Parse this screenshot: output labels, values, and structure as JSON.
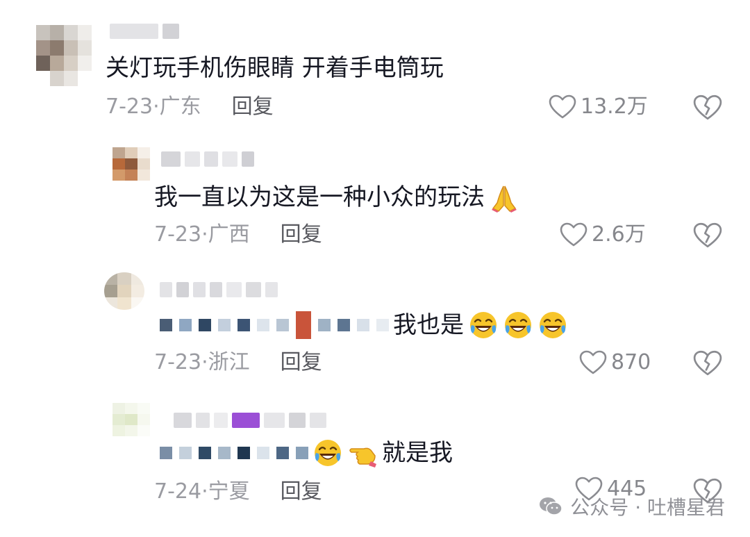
{
  "comments": [
    {
      "text": "关灯玩手机伤眼睛  开着手电筒玩",
      "date": "7-23",
      "sep": "·",
      "region": "广东",
      "reply_label": "回复",
      "likes": "13.2万"
    },
    {
      "text": "我一直以为这是一种小众的玩法",
      "date": "7-23",
      "sep": "·",
      "region": "广西",
      "reply_label": "回复",
      "likes": "2.6万"
    },
    {
      "text": "我也是",
      "date": "7-23",
      "sep": "·",
      "region": "浙江",
      "reply_label": "回复",
      "likes": "870"
    },
    {
      "text": "就是我",
      "date": "7-24",
      "sep": "·",
      "region": "宁夏",
      "reply_label": "回复",
      "likes": "445"
    }
  ],
  "watermark": {
    "text": "公众号 · 吐槽星君"
  },
  "icons": {
    "like": "heart-outline-icon",
    "dislike": "broken-heart-icon",
    "pray": "folded-hands-emoji",
    "laugh": "rolling-laughing-emoji",
    "point": "backhand-index-pointing-left-emoji"
  },
  "colors": {
    "text": "#161823",
    "meta": "#9a9ba1",
    "reply": "#58595f",
    "emoji_yellow": "#f7c52b",
    "watermark": "#8f9096"
  }
}
